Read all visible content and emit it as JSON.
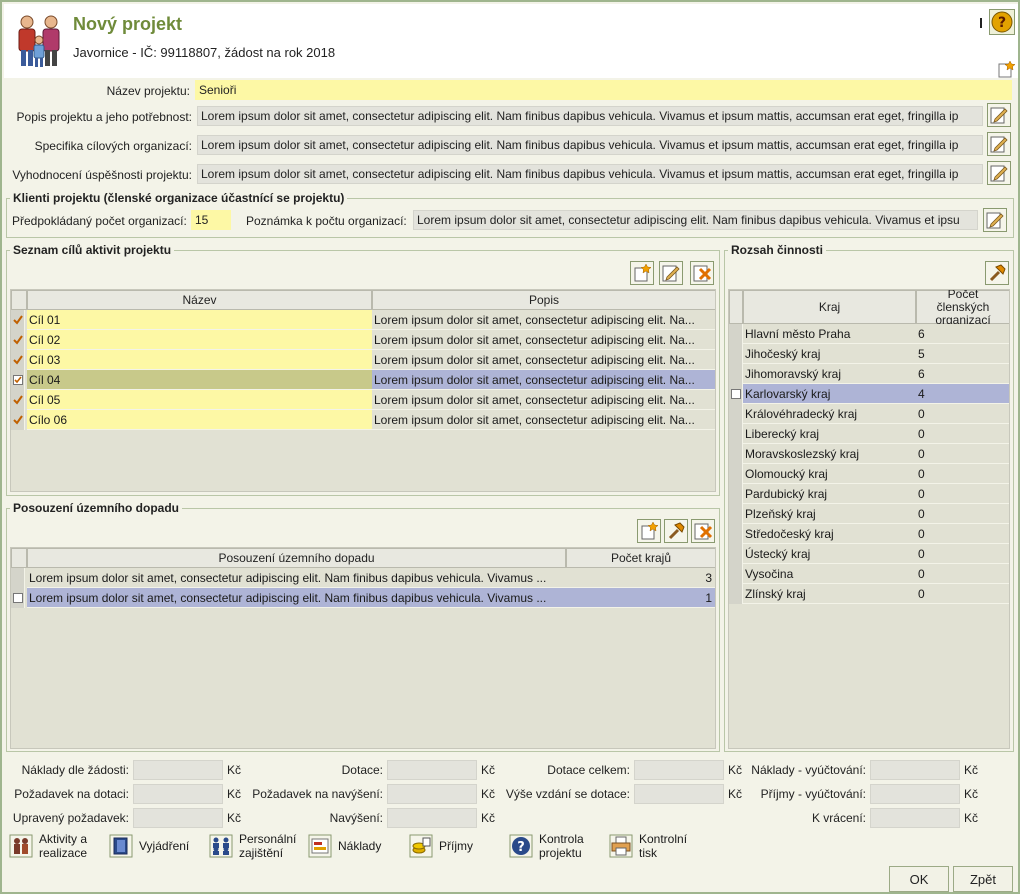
{
  "header": {
    "title": "Nový projekt",
    "subtitle": "Javornice - IČ: 99118807, žádost na rok 2018"
  },
  "form": {
    "nazev_label": "Název projektu:",
    "nazev_value": "Senioři",
    "popis_label": "Popis projektu a jeho potřebnost:",
    "popis_value": "Lorem ipsum dolor sit amet, consectetur adipiscing elit. Nam finibus dapibus vehicula. Vivamus et ipsum mattis, accumsan erat eget, fringilla ip",
    "specifika_label": "Specifika cílových organizací:",
    "specifika_value": "Lorem ipsum dolor sit amet, consectetur adipiscing elit. Nam finibus dapibus vehicula. Vivamus et ipsum mattis, accumsan erat eget, fringilla ip",
    "vyhodnoceni_label": "Vyhodnocení úspěšnosti projektu:",
    "vyhodnoceni_value": "Lorem ipsum dolor sit amet, consectetur adipiscing elit. Nam finibus dapibus vehicula. Vivamus et ipsum mattis, accumsan erat eget, fringilla ip"
  },
  "klienti": {
    "title": "Klienti projektu (členské organizace účastnící se projektu)",
    "pocet_label": "Předpokládaný počet organizací:",
    "pocet_value": "15",
    "poznamka_label": "Poznámka k počtu organizací:",
    "poznamka_value": "Lorem ipsum dolor sit amet, consectetur adipiscing elit. Nam finibus dapibus vehicula. Vivamus et ipsu"
  },
  "cile": {
    "title": "Seznam cílů aktivit projektu",
    "col_nazev": "Název",
    "col_popis": "Popis",
    "rows": [
      {
        "nazev": "Cíl 01",
        "popis": "Lorem ipsum dolor sit amet, consectetur adipiscing elit. Na..."
      },
      {
        "nazev": "Cíl 02",
        "popis": "Lorem ipsum dolor sit amet, consectetur adipiscing elit. Na..."
      },
      {
        "nazev": "Cíl 03",
        "popis": "Lorem ipsum dolor sit amet, consectetur adipiscing elit. Na..."
      },
      {
        "nazev": "Cíl 04",
        "popis": "Lorem ipsum dolor sit amet, consectetur adipiscing elit. Na..."
      },
      {
        "nazev": "Cíl 05",
        "popis": "Lorem ipsum dolor sit amet, consectetur adipiscing elit. Na..."
      },
      {
        "nazev": "Cílo 06",
        "popis": "Lorem ipsum dolor sit amet, consectetur adipiscing elit. Na..."
      }
    ]
  },
  "posouzeni": {
    "title": "Posouzení územního dopadu",
    "col_posouzeni": "Posouzení územního dopadu",
    "col_pocet": "Počet krajů",
    "rows": [
      {
        "text": "Lorem ipsum dolor sit amet, consectetur adipiscing elit. Nam finibus dapibus vehicula. Vivamus ...",
        "pocet": "3"
      },
      {
        "text": "Lorem ipsum dolor sit amet, consectetur adipiscing elit. Nam finibus dapibus vehicula. Vivamus ...",
        "pocet": "1"
      }
    ]
  },
  "rozsah": {
    "title": "Rozsah činnosti",
    "col_kraj": "Kraj",
    "col_pocet": "Počet členských organizací",
    "rows": [
      {
        "kraj": "Hlavní město Praha",
        "pocet": "6"
      },
      {
        "kraj": "Jihočeský kraj",
        "pocet": "5"
      },
      {
        "kraj": "Jihomoravský kraj",
        "pocet": "6"
      },
      {
        "kraj": "Karlovarský kraj",
        "pocet": "4"
      },
      {
        "kraj": "Královéhradecký kraj",
        "pocet": "0"
      },
      {
        "kraj": "Liberecký kraj",
        "pocet": "0"
      },
      {
        "kraj": "Moravskoslezský kraj",
        "pocet": "0"
      },
      {
        "kraj": "Olomoucký kraj",
        "pocet": "0"
      },
      {
        "kraj": "Pardubický kraj",
        "pocet": "0"
      },
      {
        "kraj": "Plzeňský kraj",
        "pocet": "0"
      },
      {
        "kraj": "Středočeský kraj",
        "pocet": "0"
      },
      {
        "kraj": "Ústecký kraj",
        "pocet": "0"
      },
      {
        "kraj": "Vysočina",
        "pocet": "0"
      },
      {
        "kraj": "Zlínský kraj",
        "pocet": "0"
      }
    ]
  },
  "money": {
    "currency": "Kč",
    "naklady_zadost": "Náklady dle žádosti:",
    "dotace": "Dotace:",
    "dotace_celkem": "Dotace celkem:",
    "naklady_vyuctovani": "Náklady - vyúčtování:",
    "pozadavek_dotaci": "Požadavek na dotaci:",
    "pozadavek_navyseni": "Požadavek na navýšení:",
    "vyse_vzdani": "Výše vzdání se dotace:",
    "prijmy_vyuctovani": "Příjmy - vyúčtování:",
    "upraveny_pozadavek": "Upravený požadavek:",
    "navyseni": "Navýšení:",
    "k_vraceni": "K vrácení:"
  },
  "nav": {
    "aktivity_1": "Aktivity a",
    "aktivity_2": "realizace",
    "vyjadreni": "Vyjádření",
    "personalni_1": "Personální",
    "personalni_2": "zajištění",
    "naklady": "Náklady",
    "prijmy": "Příjmy",
    "kontrola_1": "Kontrola",
    "kontrola_2": "projektu",
    "tisk_1": "Kontrolní",
    "tisk_2": "tisk"
  },
  "buttons": {
    "ok": "OK",
    "zpet": "Zpět"
  },
  "colors": {
    "accent": "#6f8b3a",
    "yellow": "#fdf8a5",
    "selected_row": "#aeb4d6",
    "selected_name": "#c8c98a"
  }
}
